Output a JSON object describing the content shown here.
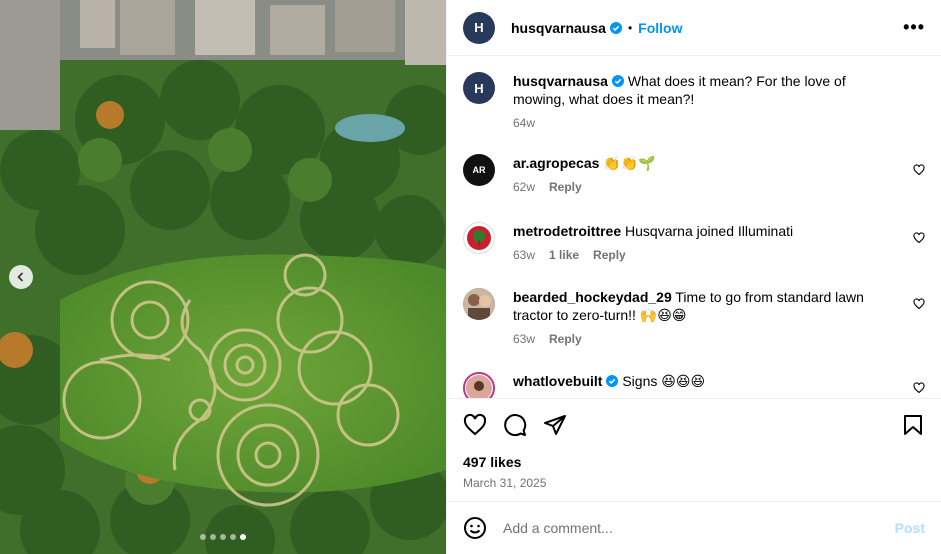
{
  "header": {
    "username": "husqvarnausa",
    "separator": "•",
    "follow_label": "Follow",
    "more_label": "•••"
  },
  "caption": {
    "username": "husqvarnausa",
    "text": "What does it mean? For the love of mowing, what does it mean?!",
    "time": "64w"
  },
  "comments": [
    {
      "username": "ar.agropecas",
      "text": "👏👏🌱",
      "time": "62w",
      "likes": "",
      "reply": "Reply"
    },
    {
      "username": "metrodetroittree",
      "text": "Husqvarna joined Illuminati",
      "time": "63w",
      "likes": "1 like",
      "reply": "Reply"
    },
    {
      "username": "bearded_hockeydad_29",
      "text": "Time to go from standard lawn tractor to zero-turn!! 🙌😆😁",
      "time": "63w",
      "likes": "",
      "reply": "Reply"
    },
    {
      "username": "whatlovebuilt",
      "text": "Signs 😆😆😆",
      "time": "",
      "likes": "",
      "reply": ""
    }
  ],
  "post": {
    "likes": "497 likes",
    "date": "March 31, 2025"
  },
  "composer": {
    "placeholder": "Add a comment...",
    "post_label": "Post"
  },
  "carousel": {
    "count": 5,
    "active": 5
  },
  "colors": {
    "accent": "#0095f6",
    "post_disabled": "#b2dffc",
    "brand_avatar": "#273a5c"
  },
  "icons": [
    "chevron-left-icon",
    "verified-icon",
    "more-icon",
    "heart-icon",
    "comment-icon",
    "share-icon",
    "bookmark-icon",
    "emoji-icon"
  ]
}
